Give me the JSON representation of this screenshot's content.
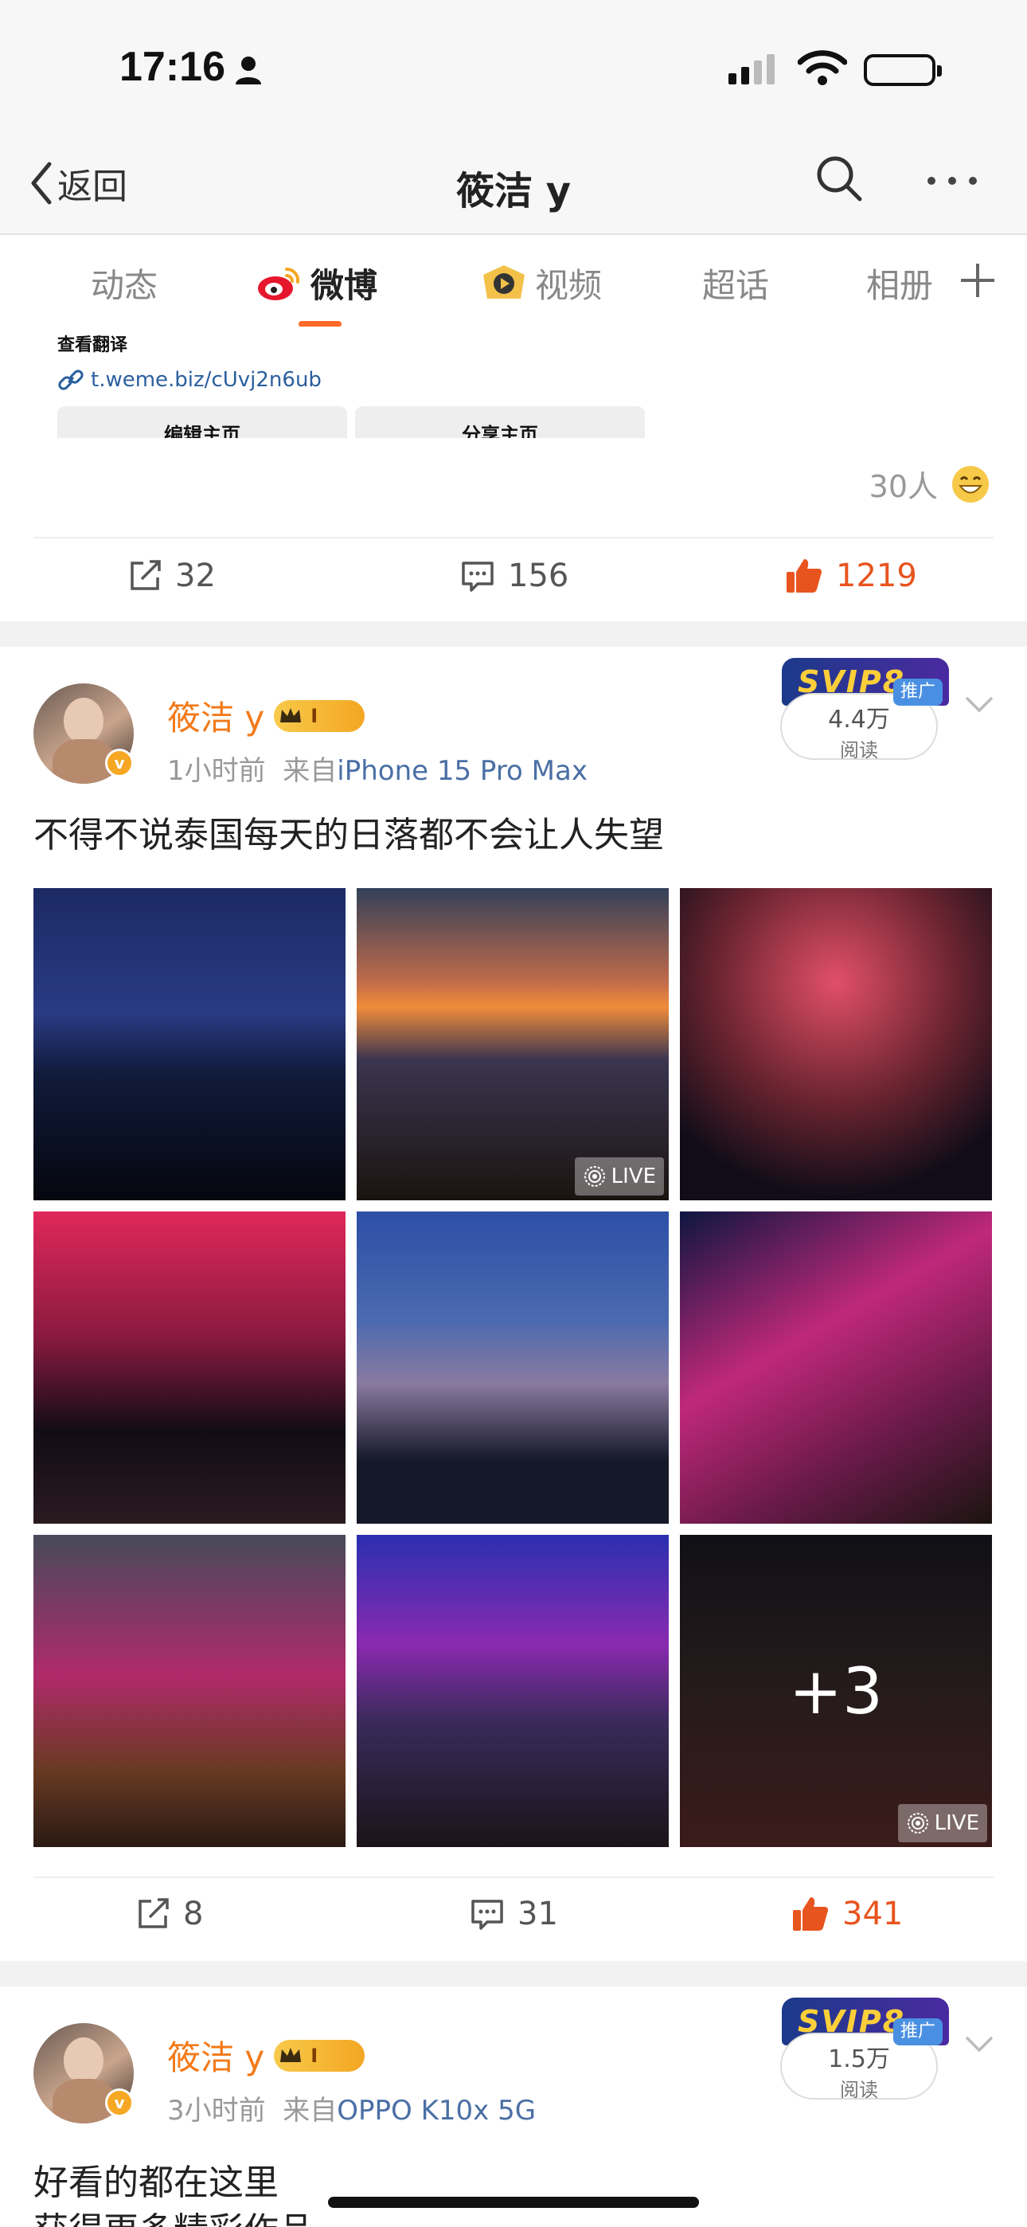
{
  "status_bar": {
    "time": "17:16"
  },
  "nav": {
    "back_label": "返回",
    "title": "筱洁 y"
  },
  "tabs": [
    {
      "label": "动态"
    },
    {
      "label": "微博"
    },
    {
      "label": "视频"
    },
    {
      "label": "超话"
    },
    {
      "label": "相册"
    }
  ],
  "embed": {
    "translate_label": "查看翻译",
    "link": "t.weme.biz/cUvj2n6ub",
    "edit_button": "编辑主页",
    "share_button": "分享主页"
  },
  "card1": {
    "likers": "30人",
    "reposts": "32",
    "comments": "156",
    "likes": "1219"
  },
  "posts": [
    {
      "author": "筱洁 y",
      "level_badge": "I",
      "time": "1小时前",
      "source_prefix": "来自",
      "device": "iPhone 15 Pro Max",
      "promo_brand": "SVIP8",
      "promo_tag": "推广",
      "read_count": "4.4万",
      "read_label": "阅读",
      "text": "不得不说泰国每天的日落都不会让人失望",
      "live_label": "LIVE",
      "more_photos": "+3",
      "reposts": "8",
      "comments": "31",
      "likes": "341"
    },
    {
      "author": "筱洁 y",
      "level_badge": "I",
      "time": "3小时前",
      "source_prefix": "来自",
      "device": "OPPO K10x 5G",
      "promo_brand": "SVIP8",
      "promo_tag": "推广",
      "read_count": "1.5万",
      "read_label": "阅读",
      "text": "好看的都在这里",
      "text2": "获得更多精彩作品"
    }
  ],
  "colors": {
    "accent": "#ff6a2a",
    "like": "#e8541e",
    "author": "#f27a1a",
    "link": "#4a6fa5"
  }
}
